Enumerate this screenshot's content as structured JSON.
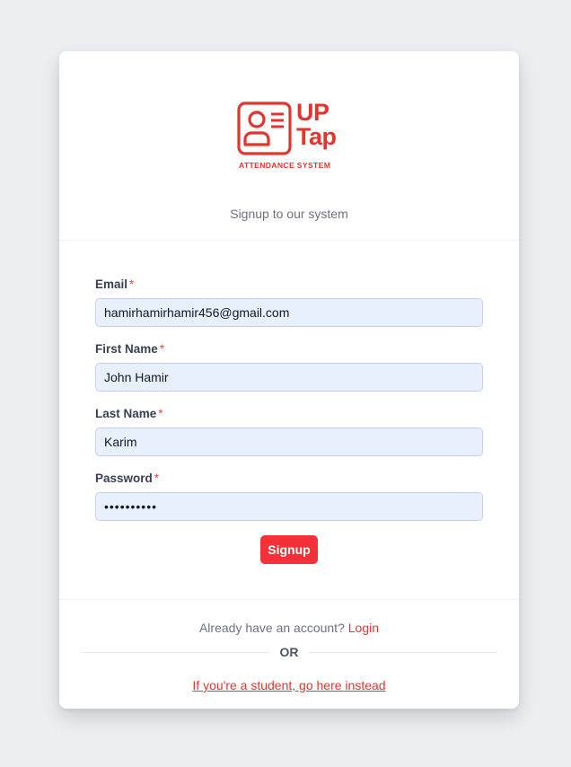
{
  "brand": {
    "name_line1": "UP",
    "name_line2": "Tap",
    "tagline": "ATTENDANCE SYSTEM",
    "color": "#e3342f"
  },
  "subtitle": "Signup to our system",
  "form": {
    "fields": [
      {
        "label": "Email",
        "required_mark": "*",
        "value": "hamirhamirhamir456@gmail.com",
        "type": "email"
      },
      {
        "label": "First Name",
        "required_mark": "*",
        "value": "John Hamir",
        "type": "text"
      },
      {
        "label": "Last Name",
        "required_mark": "*",
        "value": "Karim",
        "type": "text"
      },
      {
        "label": "Password",
        "required_mark": "*",
        "value": "••••••••••",
        "type": "password"
      }
    ],
    "submit_label": "Signup",
    "submit_color": "#f43138"
  },
  "footer": {
    "already_text": "Already have an account?",
    "login_label": "Login",
    "or_text": "OR",
    "student_link": "If you're a student, go here instead"
  },
  "icons": {
    "logo": "id-card-icon"
  }
}
